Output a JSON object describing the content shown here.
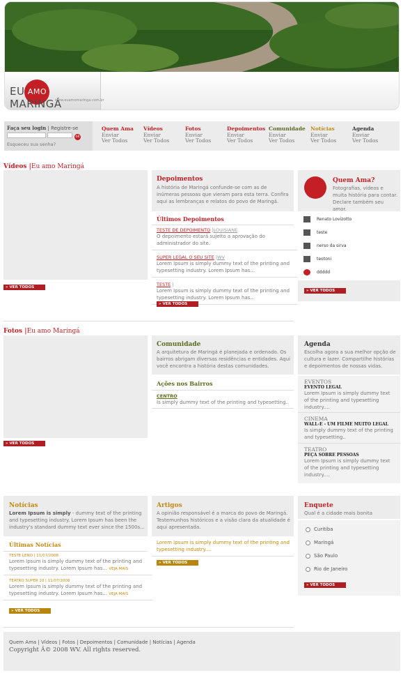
{
  "logo": {
    "pre": "EU",
    "circle": "AMO",
    "post": "MARINGÁ",
    "url": "www.euamomaringa.com.br"
  },
  "login": {
    "label": "Faça seu login",
    "register": "Registre-se",
    "ok": "ok",
    "forgot": "Esqueceu sua senha?"
  },
  "nav": [
    {
      "title": "Quem Ama",
      "l1": "Enviar",
      "l2": "Ver Todos",
      "color": "#c41f25"
    },
    {
      "title": "Vídeos",
      "l1": "Enviar",
      "l2": "Ver Todos",
      "color": "#c41f25"
    },
    {
      "title": "Fotos",
      "l1": "Enviar",
      "l2": "Ver Todos",
      "color": "#c41f25"
    },
    {
      "title": "Depoimentos",
      "l1": "Enviar",
      "l2": "Ver Todos",
      "color": "#c41f25"
    },
    {
      "title": "Comunidade",
      "l1": "Enviar",
      "l2": "Ver Todos",
      "color": "#5a6b1f"
    },
    {
      "title": "Notícias",
      "l1": "Enviar",
      "l2": "Ver Todos",
      "color": "#c38a10"
    },
    {
      "title": "Agenda",
      "l1": "Enviar",
      "l2": "Ver Todos",
      "color": "#333333"
    }
  ],
  "videos": {
    "title": "Vídeos",
    "sub": "Eu amo Maringá",
    "ver": "» VER TODOS"
  },
  "depoimentos": {
    "title": "Depoimentos",
    "text": "A história de Maringá confunde-se com as de inúmeras pessoas que vieram para esta terra. Confira aqui as lembranças e relatos do povo de Maringá.",
    "last": "Últimos Depoimentos",
    "items": [
      {
        "link": "TESTE DE DEPOIMENTO",
        "author": "LOUISIANE",
        "text": "O depoimento estará sujeito a aprovação do administrador do site."
      },
      {
        "link": "SUPER LEGAL O SEU SITE",
        "author": "WV",
        "text": "Lorem Ipsum is simply dummy text of the printing and typesetting industry. Lorem Ipsum has..."
      },
      {
        "link": "TESTE",
        "author": "",
        "text": "Lorem Ipsum is simply dummy text of the printing and typesetting industry. Lorem Ipsum has..."
      }
    ],
    "ver": "» VER TODOS"
  },
  "quemama": {
    "title": "Quem Ama?",
    "text": "Fotografias, vídeos e muita história para contar. Declare também seu amor.",
    "users": [
      "Renato Lovizotto",
      "teste",
      "nerso da sirva",
      "teotoni",
      "ddddd"
    ],
    "ver": "» VER TODOS"
  },
  "fotos": {
    "title": "Fotos",
    "sub": "Eu amo Maringá",
    "ver": "» VER TODOS"
  },
  "comunidade": {
    "title": "Comunidade",
    "text": "A arquitetura de Maringá é planejada e ordenado. Os bairros abrigam diversas residências e entidades. Aqui você encontra a história destas comunidades.",
    "acoes": "Ações nos Bairros",
    "item_link": "CENTRO",
    "item_text": "Is simply dummy text of the printing and typesetting.."
  },
  "agenda": {
    "title": "Agenda",
    "text": "Escolha agora a sua melhor opção de cultura e lazer. Compartilhe histórias e depoimentos de nossas vidas.",
    "events": [
      {
        "cat": "EVENTOS",
        "name": "EVENTO LEGAL",
        "text": "Lorem Ipsum is simply dummy text of the printing and typesetting industry...."
      },
      {
        "cat": "CINEMA",
        "name": "WALL-E - UM FILME MUITO LEGAL",
        "text": "Is simply dummy text of the printing and typesetting.."
      },
      {
        "cat": "TEATRO",
        "name": "PEÇA SOBRE PESSOAS",
        "text": "Lorem Ipsum is simply dummy text of the printing and typesetting industry...."
      }
    ]
  },
  "noticias": {
    "title": "Notícias",
    "text_bold": "Lorem Ipsum is simply",
    "text": " - dummy text of the printing and typesetting industry. Lorem Ipsum has been the industry's standard dummy text ever since the 1500s...",
    "last": "Últimas Notícias",
    "items": [
      {
        "head": "TESTE LENO | 11/07/2008",
        "text": "Lorem Ipsum is simply dummy text of the printing and typesetting industry. Lorem Ipsum has...",
        "more": "VEJA MAIS"
      },
      {
        "head": "TEATRO SUPER 10 | 11/07/2008",
        "text": "Lorem Ipsum is simply dummy text of the printing and typesetting industry. Lorem Ipsum has...",
        "more": "VEJA MAIS"
      }
    ],
    "ver": "» VER TODOS"
  },
  "artigos": {
    "title": "Artigos",
    "text": "A opinião responsável é a marca do povo de Maringá. Testemunhos históricos e a visão clara da atualidade é aqui apresentada.",
    "link": "Lorem Ipsum is simply dummy text of the printing and typesetting industry....",
    "ver": "» VER TODOS"
  },
  "enquete": {
    "title": "Enquete",
    "question": "Qual é a cidade mais bonita",
    "options": [
      "Curitiba",
      "Maringá",
      "São Paulo",
      "Rio de Janeiro"
    ],
    "ver": "» VER TODOS"
  },
  "footer": {
    "links": "Quem Ama | Vídeos | Fotos | Depoimentos | Comunidade | Notícias | Agenda",
    "copyright": "Copyright Â© 2008 WV. All rights reserved."
  }
}
